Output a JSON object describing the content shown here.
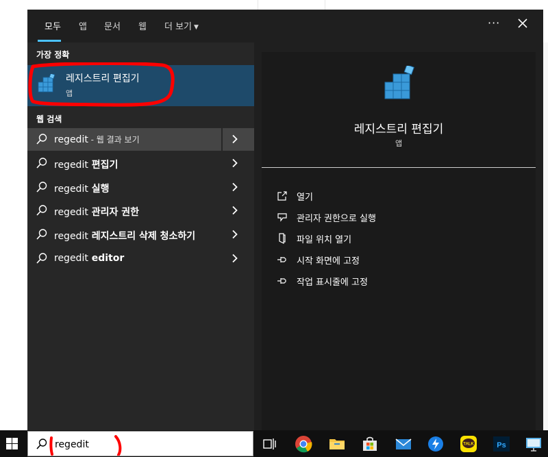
{
  "tabs": [
    {
      "label": "모두",
      "active": true
    },
    {
      "label": "앱",
      "active": false
    },
    {
      "label": "문서",
      "active": false
    },
    {
      "label": "웹",
      "active": false
    },
    {
      "label": "더 보기",
      "active": false
    }
  ],
  "window_controls": {
    "more": "···"
  },
  "left": {
    "best_match_heading": "가장 정확",
    "best_match": {
      "name": "레지스트리 편집기",
      "type": "앱"
    },
    "web_heading": "웹 검색",
    "rows": [
      {
        "query": "regedit",
        "suffix": " - 웹 결과 보기"
      },
      {
        "query": "regedit",
        "suffix": " 편집기"
      },
      {
        "query": "regedit",
        "suffix": " 실행"
      },
      {
        "query": "regedit",
        "suffix": " 관리자 권한"
      },
      {
        "query": "regedit",
        "suffix": " 레지스트리 삭제 청소하기"
      },
      {
        "query": "regedit",
        "suffix": " editor"
      }
    ]
  },
  "right": {
    "title": "레지스트리 편집기",
    "type": "앱",
    "actions": [
      {
        "label": "열기",
        "icon": "open-icon"
      },
      {
        "label": "관리자 권한으로 실행",
        "icon": "shield-icon"
      },
      {
        "label": "파일 위치 열기",
        "icon": "file-location-icon"
      },
      {
        "label": "시작 화면에 고정",
        "icon": "pin-icon"
      },
      {
        "label": "작업 표시줄에 고정",
        "icon": "pin-icon"
      }
    ]
  },
  "taskbar": {
    "search_value": "regedit",
    "apps": [
      {
        "name": "task-view-icon"
      },
      {
        "name": "chrome-icon"
      },
      {
        "name": "file-explorer-icon"
      },
      {
        "name": "microsoft-store-icon"
      },
      {
        "name": "mail-icon"
      },
      {
        "name": "messenger-icon"
      },
      {
        "name": "kakaotalk-icon",
        "label": "TALK"
      },
      {
        "name": "photoshop-icon",
        "label": "Ps"
      },
      {
        "name": "remote-desktop-icon"
      }
    ]
  },
  "colors": {
    "accent": "#4cc2ff",
    "best_match_bg": "#1e4a6a",
    "annotation": "#ff0000"
  }
}
